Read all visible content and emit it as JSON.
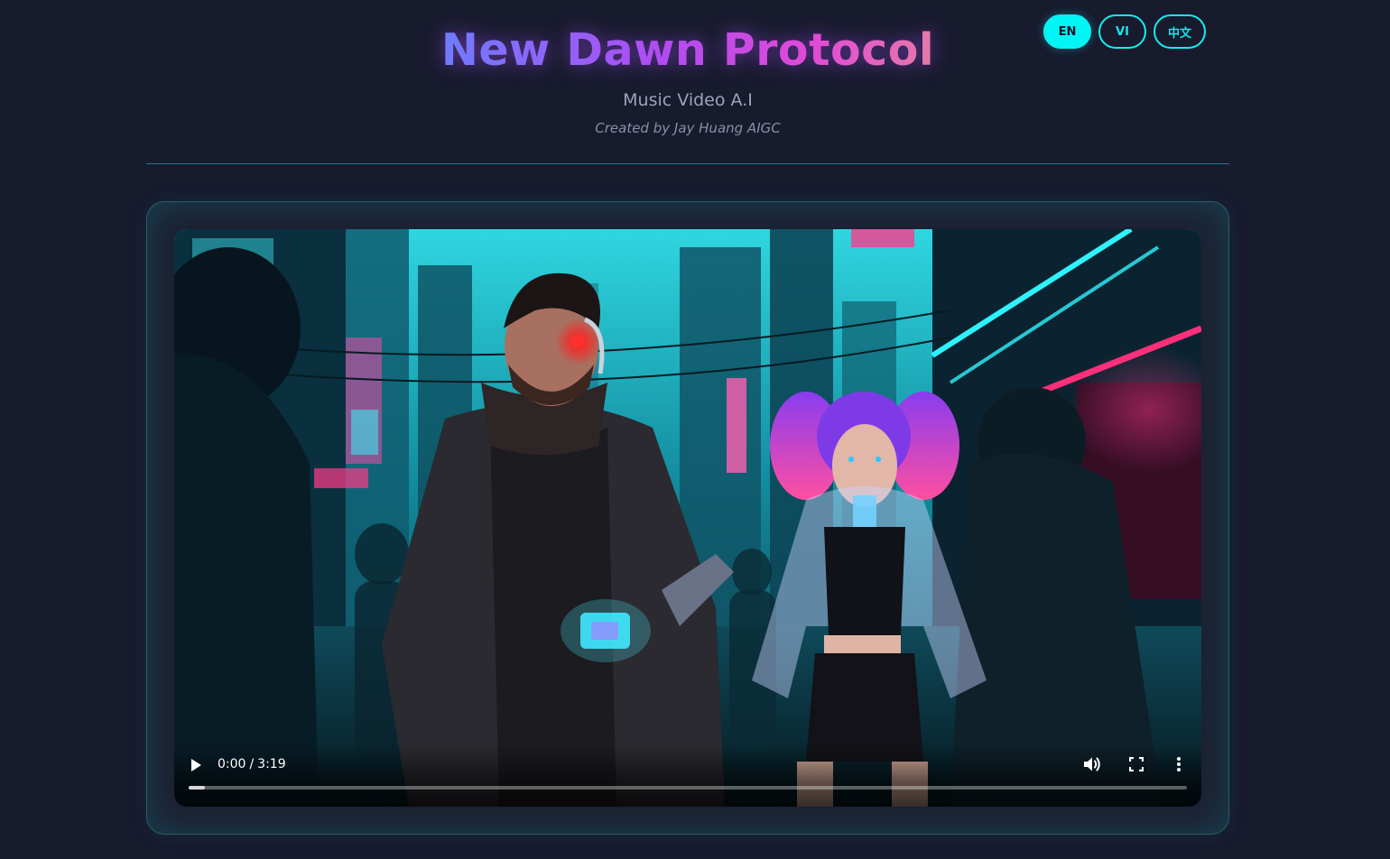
{
  "header": {
    "title": "New Dawn Protocol",
    "subtitle": "Music Video A.I",
    "credit": "Created by Jay Huang AIGC"
  },
  "languages": [
    {
      "label": "EN",
      "active": true
    },
    {
      "label": "VI",
      "active": false
    },
    {
      "label": "中文",
      "active": false
    }
  ],
  "video": {
    "current_time": "0:00",
    "separator": "/",
    "duration": "3:19",
    "buffered_fraction": 0.016,
    "icons": {
      "play": "play-icon",
      "volume": "volume-icon",
      "fullscreen": "fullscreen-icon",
      "more": "more-options-icon"
    }
  },
  "colors": {
    "background": "#181a2e",
    "accent_cyan": "#00f5f5",
    "title_gradient_start": "#6f7cff",
    "title_gradient_end": "#e57aa8",
    "divider": "#1e7e86"
  }
}
